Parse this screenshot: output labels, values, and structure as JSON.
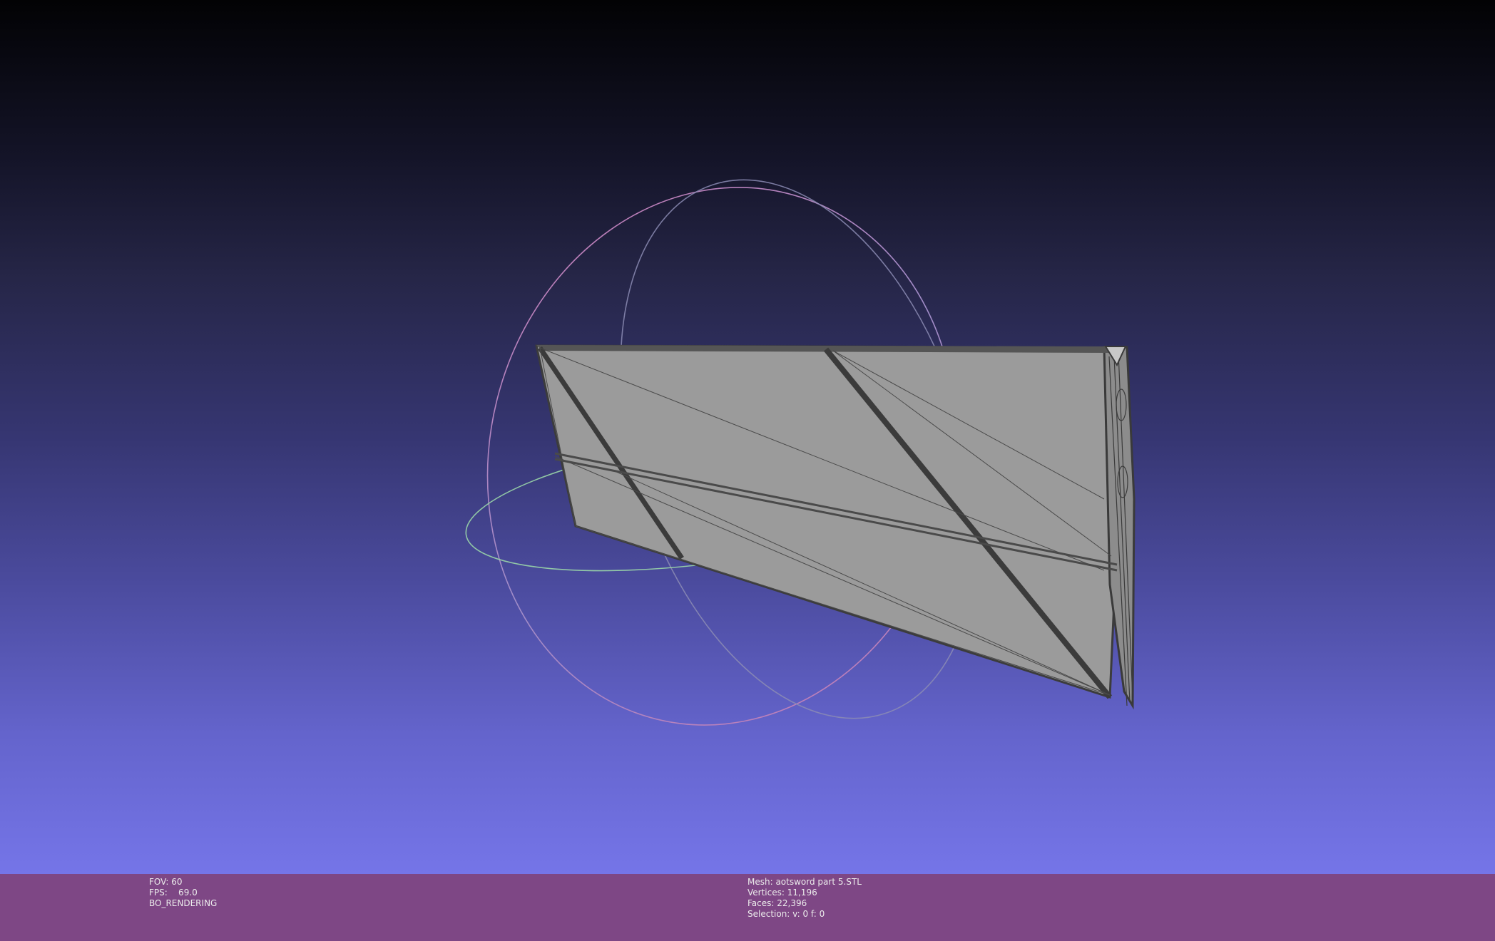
{
  "viewport": {
    "background_top": "#020204",
    "background_bottom": "#7575e8",
    "mesh_color": "#9b9b9b",
    "edge_color": "#3c3c3c",
    "trackball_colors": [
      "#c87ab4",
      "#8c8cb4",
      "#9ad6a8"
    ]
  },
  "status": {
    "left": {
      "fov": "FOV: 60",
      "fps": "FPS:    69.0",
      "mode": "BO_RENDERING"
    },
    "right": {
      "mesh": "Mesh: aotsword part 5.STL",
      "vertices": "Vertices: 11,196",
      "faces": "Faces: 22,396",
      "selection": "Selection: v: 0 f: 0"
    },
    "background_color": "#7e4785",
    "text_color": "#ececec"
  }
}
